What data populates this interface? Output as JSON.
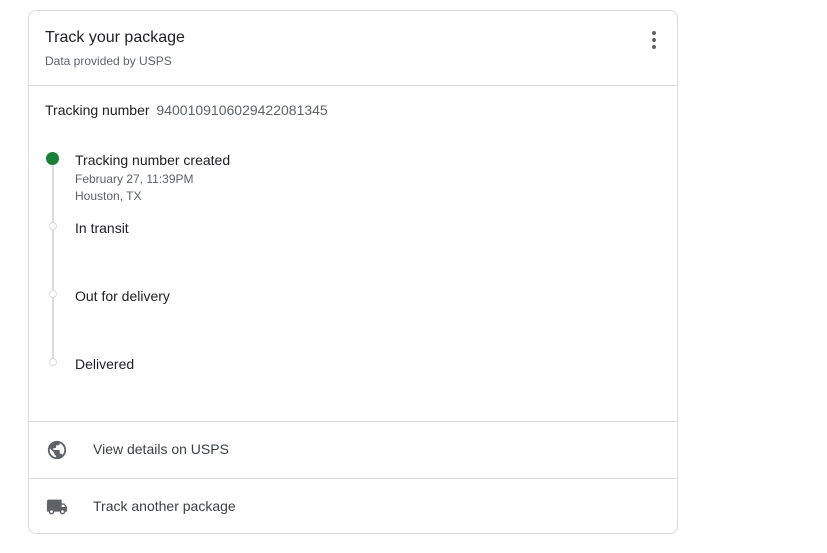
{
  "header": {
    "title": "Track your package",
    "subtitle": "Data provided by USPS",
    "menu_icon": "more-vert-icon"
  },
  "tracking": {
    "label": "Tracking number",
    "number": "9400109106029422081345"
  },
  "timeline": {
    "steps": [
      {
        "label": "Tracking number created",
        "date": "February 27, 11:39PM",
        "location": "Houston, TX",
        "status": "completed"
      },
      {
        "label": "In transit",
        "status": "pending"
      },
      {
        "label": "Out for delivery",
        "status": "pending"
      },
      {
        "label": "Delivered",
        "status": "pending"
      }
    ],
    "active_color": "#188038"
  },
  "actions": [
    {
      "label": "View details on USPS",
      "icon": "globe-icon"
    },
    {
      "label": "Track another package",
      "icon": "truck-icon"
    }
  ]
}
